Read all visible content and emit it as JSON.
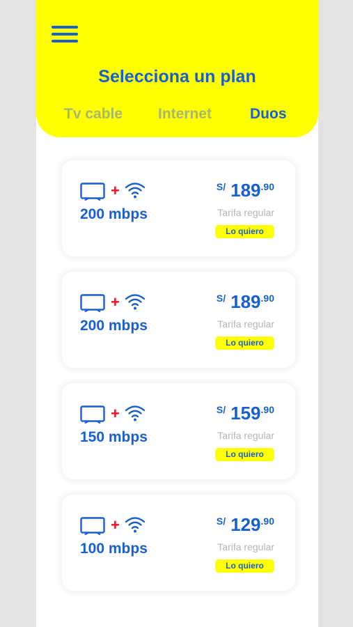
{
  "header": {
    "title": "Selecciona un plan",
    "tabs": [
      {
        "label": "Tv cable",
        "active": false
      },
      {
        "label": "Internet",
        "active": false
      },
      {
        "label": "Duos",
        "active": true
      }
    ]
  },
  "colors": {
    "brand_yellow": "#ffff00",
    "brand_blue": "#1a5fd0",
    "plus_red": "#e8132a",
    "inactive_tab": "#a6b870",
    "muted_text": "#b5b5b5"
  },
  "plans": [
    {
      "speed": "200 mbps",
      "currency": "S/",
      "price_int": "189",
      "price_dec": ".90",
      "note": "Tarifa regular",
      "cta": "Lo quiero"
    },
    {
      "speed": "200 mbps",
      "currency": "S/",
      "price_int": "189",
      "price_dec": ".90",
      "note": "Tarifa regular",
      "cta": "Lo quiero"
    },
    {
      "speed": "150 mbps",
      "currency": "S/",
      "price_int": "159",
      "price_dec": ".90",
      "note": "Tarifa regular",
      "cta": "Lo quiero"
    },
    {
      "speed": "100 mbps",
      "currency": "S/",
      "price_int": "129",
      "price_dec": ".90",
      "note": "Tarifa regular",
      "cta": "Lo quiero"
    }
  ],
  "icons": {
    "menu": "hamburger-menu-icon",
    "tv": "tv-icon",
    "plus": "plus-icon",
    "wifi": "wifi-icon"
  }
}
